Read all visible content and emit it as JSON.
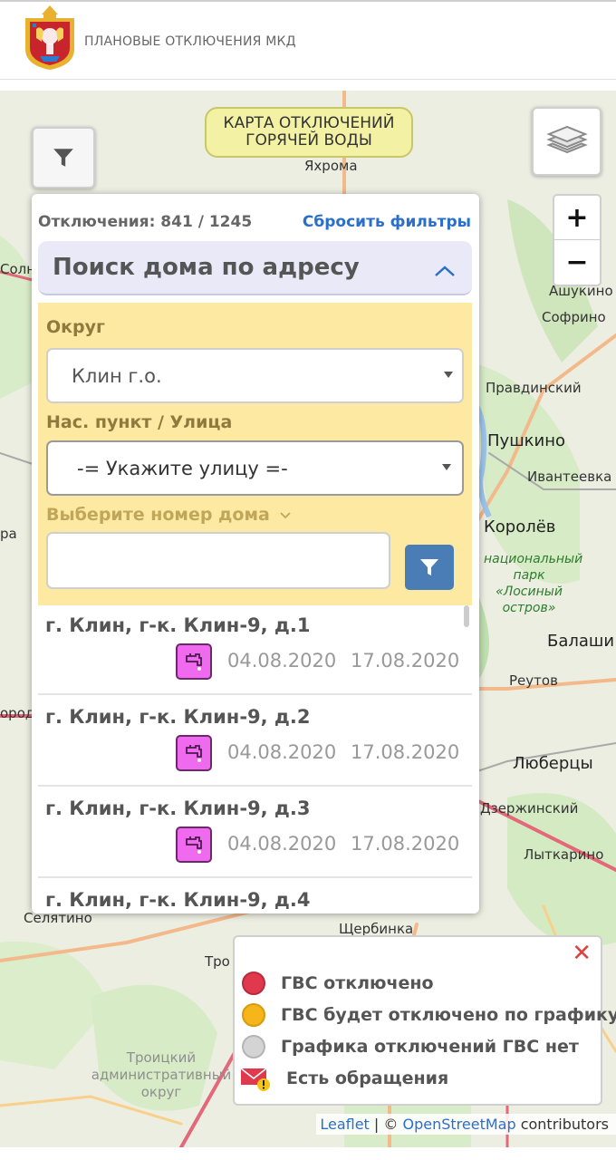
{
  "header": {
    "title": "ПЛАНОВЫЕ ОТКЛЮЧЕНИЯ МКД"
  },
  "map": {
    "badge_line1": "КАРТА ОТКЛЮЧЕНИЙ",
    "badge_line2": "ГОРЯЧЕЙ ВОДЫ",
    "zoom_in": "+",
    "zoom_out": "−",
    "places": {
      "yakhroma": "Яхрома",
      "solnechnogorsk": "Солн",
      "ashukino": "Ашукино",
      "sofrino": "Софрино",
      "pravdinsky": "Правдинский",
      "pushkino": "Пушкино",
      "ivanteevka": "Ивантеевка",
      "korolev": "Королёв",
      "losiny": "национальный парк «Лосиный остров»",
      "balashikha": "Балаши",
      "reutov": "Реутов",
      "lyubertsy": "Люберцы",
      "dzerzhinsky": "Дзержинский",
      "lytkarino": "Лыткарино",
      "selyatino": "Селятино",
      "shcherbinka": "Щербинка",
      "troitsk_short": "Тро",
      "troitsky_okrug": "Троицкий административный округ",
      "rp": "ра",
      "rod": "ород"
    }
  },
  "panel": {
    "count": "Отключения: 841 / 1245",
    "reset": "Сбросить фильтры",
    "search_title": "Поиск дома по адресу",
    "district_label": "Округ",
    "district_value": "Клин г.о.",
    "street_label": "Нас. пункт / Улица",
    "street_value": "-= Укажите улицу =-",
    "house_label": "Выберите номер дома",
    "house_value": "",
    "results": [
      {
        "address": "г. Клин, г-к. Клин-9, д.1",
        "start": "04.08.2020",
        "end": "17.08.2020"
      },
      {
        "address": "г. Клин, г-к. Клин-9, д.2",
        "start": "04.08.2020",
        "end": "17.08.2020"
      },
      {
        "address": "г. Клин, г-к. Клин-9, д.3",
        "start": "04.08.2020",
        "end": "17.08.2020"
      },
      {
        "address": "г. Клин, г-к. Клин-9, д.4",
        "start": "",
        "end": ""
      }
    ]
  },
  "legend": {
    "close": "✕",
    "items": [
      {
        "label": "ГВС отключено",
        "color": "#e0394e"
      },
      {
        "label": "ГВС будет отключено по графику",
        "color": "#f5b51b"
      },
      {
        "label": "Графика отключений ГВС нет",
        "color": "#d4d4d4"
      },
      {
        "label": "Есть обращения",
        "color": "#e0394e"
      }
    ]
  },
  "attribution": {
    "leaflet": "Leaflet",
    "sep": " | © ",
    "osm": "OpenStreetMap",
    "contrib": " contributors"
  }
}
